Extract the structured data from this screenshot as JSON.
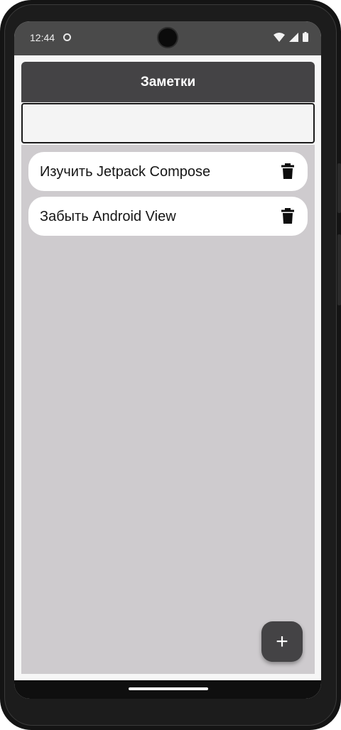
{
  "status_bar": {
    "time": "12:44",
    "icons": [
      "sync-icon",
      "wifi-icon",
      "signal-icon",
      "battery-icon"
    ]
  },
  "app_bar": {
    "title": "Заметки"
  },
  "search": {
    "value": "",
    "placeholder": ""
  },
  "notes": [
    {
      "text": "Изучить Jetpack Compose",
      "action_icon": "trash-icon"
    },
    {
      "text": "Забыть Android View",
      "action_icon": "trash-icon"
    }
  ],
  "fab": {
    "label": "+",
    "icon": "plus-icon"
  },
  "colors": {
    "app_bar": "#444345",
    "content_background": "#cecbce",
    "note_card": "#ffffff",
    "fab": "#444345"
  }
}
